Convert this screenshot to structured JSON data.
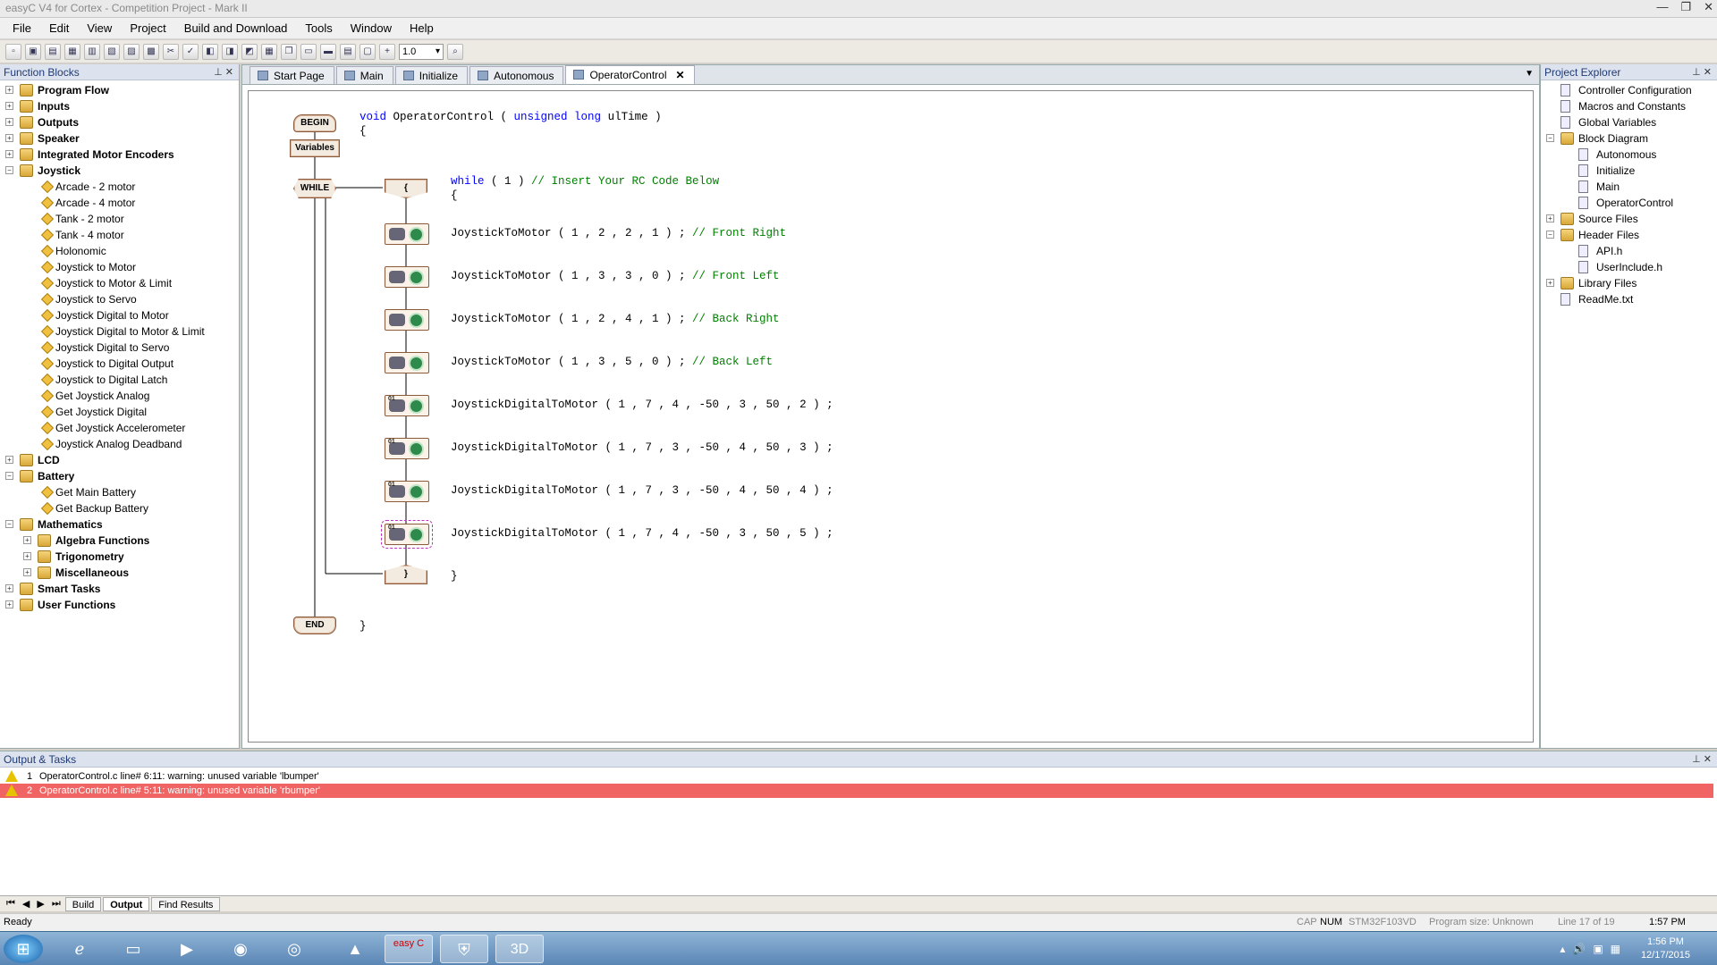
{
  "window": {
    "title": "easyC V4 for Cortex - Competition Project - Mark II",
    "min": "—",
    "max": "❐",
    "close": "✕"
  },
  "menu": [
    "File",
    "Edit",
    "View",
    "Project",
    "Build and Download",
    "Tools",
    "Window",
    "Help"
  ],
  "toolbar": {
    "zoom": "1.0"
  },
  "function_blocks": {
    "title": "Function Blocks",
    "items": [
      {
        "label": "Program Flow",
        "level": 0,
        "bold": true
      },
      {
        "label": "Inputs",
        "level": 0,
        "bold": true
      },
      {
        "label": "Outputs",
        "level": 0,
        "bold": true
      },
      {
        "label": "Speaker",
        "level": 0,
        "bold": true
      },
      {
        "label": "Integrated Motor Encoders",
        "level": 0,
        "bold": true
      },
      {
        "label": "Joystick",
        "level": 0,
        "bold": true,
        "open": true
      },
      {
        "label": "Arcade - 2 motor",
        "level": 1
      },
      {
        "label": "Arcade - 4 motor",
        "level": 1
      },
      {
        "label": "Tank - 2 motor",
        "level": 1
      },
      {
        "label": "Tank - 4 motor",
        "level": 1
      },
      {
        "label": "Holonomic",
        "level": 1
      },
      {
        "label": "Joystick to Motor",
        "level": 1
      },
      {
        "label": "Joystick to Motor & Limit",
        "level": 1
      },
      {
        "label": "Joystick to Servo",
        "level": 1
      },
      {
        "label": "Joystick Digital to Motor",
        "level": 1
      },
      {
        "label": "Joystick Digital to Motor & Limit",
        "level": 1
      },
      {
        "label": "Joystick Digital to Servo",
        "level": 1
      },
      {
        "label": "Joystick to Digital Output",
        "level": 1
      },
      {
        "label": "Joystick to Digital Latch",
        "level": 1
      },
      {
        "label": "Get Joystick Analog",
        "level": 1
      },
      {
        "label": "Get Joystick Digital",
        "level": 1
      },
      {
        "label": "Get Joystick Accelerometer",
        "level": 1
      },
      {
        "label": "Joystick Analog Deadband",
        "level": 1
      },
      {
        "label": "LCD",
        "level": 0,
        "bold": true
      },
      {
        "label": "Battery",
        "level": 0,
        "bold": true,
        "open": true
      },
      {
        "label": "Get Main Battery",
        "level": 1
      },
      {
        "label": "Get Backup Battery",
        "level": 1
      },
      {
        "label": "Mathematics",
        "level": 0,
        "bold": true,
        "open": true
      },
      {
        "label": "Algebra Functions",
        "level": 1,
        "bold": true,
        "folder": true
      },
      {
        "label": "Trigonometry",
        "level": 1,
        "bold": true,
        "folder": true
      },
      {
        "label": "Miscellaneous",
        "level": 1,
        "bold": true,
        "folder": true
      },
      {
        "label": "Smart Tasks",
        "level": 0,
        "bold": true
      },
      {
        "label": "User Functions",
        "level": 0,
        "bold": true
      }
    ]
  },
  "tabs": [
    {
      "label": "Start Page"
    },
    {
      "label": "Main"
    },
    {
      "label": "Initialize"
    },
    {
      "label": "Autonomous"
    },
    {
      "label": "OperatorControl",
      "active": true
    }
  ],
  "flow": {
    "begin": "BEGIN",
    "variables": "Variables",
    "while": "WHILE",
    "open": "{",
    "close": "}",
    "end": "END",
    "decl_void": "void",
    "decl_name": " OperatorControl ( ",
    "decl_type": "unsigned long",
    "decl_rest": " ulTime )",
    "brace_open": "{",
    "brace_close": "}",
    "while_kw": "while",
    "while_cond": " ( 1 ) ",
    "while_comment": "// Insert Your RC Code Below",
    "while_brace": "{",
    "while_end": "}",
    "lines": [
      {
        "code": "JoystickToMotor ( 1 , 2 , 2 , 1 ) ; ",
        "comment": "// Front Right",
        "digital": false
      },
      {
        "code": "JoystickToMotor ( 1 , 3 , 3 , 0 ) ; ",
        "comment": "// Front Left",
        "digital": false
      },
      {
        "code": "JoystickToMotor ( 1 , 2 , 4 , 1 ) ; ",
        "comment": "// Back Right",
        "digital": false
      },
      {
        "code": "JoystickToMotor ( 1 , 3 , 5 , 0 ) ; ",
        "comment": "// Back Left",
        "digital": false
      },
      {
        "code": "JoystickDigitalToMotor ( 1 , 7 , 4 , -50 , 3 , 50 , 2 ) ;",
        "comment": "",
        "digital": true
      },
      {
        "code": "JoystickDigitalToMotor ( 1 , 7 , 3 , -50 , 4 , 50 , 3 ) ;",
        "comment": "",
        "digital": true
      },
      {
        "code": "JoystickDigitalToMotor ( 1 , 7 , 3 , -50 , 4 , 50 , 4 ) ;",
        "comment": "",
        "digital": true
      },
      {
        "code": "JoystickDigitalToMotor ( 1 , 7 , 4 , -50 , 3 , 50 , 5 ) ;",
        "comment": "",
        "digital": true,
        "selected": true
      }
    ],
    "digital_badge": "01"
  },
  "project_explorer": {
    "title": "Project Explorer",
    "items": [
      {
        "label": "Controller Configuration",
        "level": 0
      },
      {
        "label": "Macros and Constants",
        "level": 0
      },
      {
        "label": "Global Variables",
        "level": 0
      },
      {
        "label": "Block Diagram",
        "level": 0,
        "open": true
      },
      {
        "label": "Autonomous",
        "level": 1
      },
      {
        "label": "Initialize",
        "level": 1
      },
      {
        "label": "Main",
        "level": 1
      },
      {
        "label": "OperatorControl",
        "level": 1
      },
      {
        "label": "Source Files",
        "level": 0
      },
      {
        "label": "Header Files",
        "level": 0,
        "open": true
      },
      {
        "label": "API.h",
        "level": 1
      },
      {
        "label": "UserInclude.h",
        "level": 1
      },
      {
        "label": "Library Files",
        "level": 0
      },
      {
        "label": "ReadMe.txt",
        "level": 0
      }
    ]
  },
  "output": {
    "title": "Output & Tasks",
    "rows": [
      {
        "num": "1",
        "text": "OperatorControl.c line# 6:11: warning: unused variable 'lbumper'"
      },
      {
        "num": "2",
        "text": "OperatorControl.c line# 5:11: warning: unused variable 'rbumper'",
        "selected": true
      }
    ],
    "tabs": [
      "Build",
      "Output",
      "Find Results"
    ],
    "active_tab": "Output",
    "nav": [
      "⏮",
      "◀",
      "▶",
      "⏭"
    ]
  },
  "status": {
    "ready": "Ready",
    "cap": "CAP",
    "num": "NUM",
    "chip": "STM32F103VD",
    "progsize": "Program size: Unknown",
    "line": "Line  17  of  19",
    "time": "1:57 PM"
  },
  "taskbar": {
    "apps": [
      "start",
      "ie",
      "explorer",
      "media",
      "firefox",
      "chrome",
      "autodesk",
      "easyc",
      "shield",
      "3d"
    ],
    "easyc_label": "easy C",
    "label_3d": "3D",
    "time": "1:56 PM",
    "date": "12/17/2015"
  },
  "colors": {
    "selected_row": "#f06464",
    "comment": "#008000",
    "keyword": "#0000ff",
    "block_border": "#8b5a3c"
  }
}
